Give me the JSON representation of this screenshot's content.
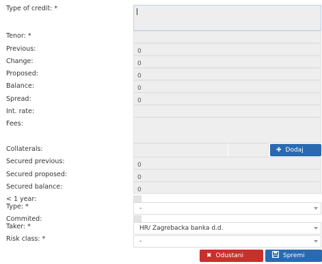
{
  "labels": {
    "type_of_credit": "Type of credit: *",
    "tenor": "Tenor: *",
    "previous": "Previous:",
    "change": "Change:",
    "proposed": "Proposed:",
    "balance": "Balance:",
    "spread": "Spread:",
    "int_rate": "Int. rate:",
    "fees": "Fees:",
    "collaterals": "Collaterals:",
    "secured_previous": "Secured previous:",
    "secured_proposed": "Secured proposed:",
    "secured_balance": "Secured balance:",
    "less_1_year": "< 1 year:",
    "type": "Type: *",
    "commited": "Commited:",
    "taker": "Taker: *",
    "risk_class": "Risk class: *"
  },
  "values": {
    "type_of_credit": "",
    "tenor": "",
    "previous": "0",
    "change": "0",
    "proposed": "0",
    "balance": "0",
    "spread": "0",
    "int_rate": "",
    "fees": "",
    "secured_previous": "0",
    "secured_proposed": "0",
    "secured_balance": "0"
  },
  "selects": {
    "type": "-",
    "taker": "HR/ Zagrebacka banka d.d.",
    "risk_class": "-"
  },
  "buttons": {
    "dodaj": "Dodaj",
    "cancel": "Odustani",
    "save": "Spremi"
  },
  "icons": {
    "dodaj": "plus-icon",
    "cancel": "x-icon",
    "save": "floppy-disk-icon"
  },
  "colors": {
    "primary": "#2a6ab1",
    "danger": "#c9302c",
    "field_bg": "#eeeeee"
  }
}
